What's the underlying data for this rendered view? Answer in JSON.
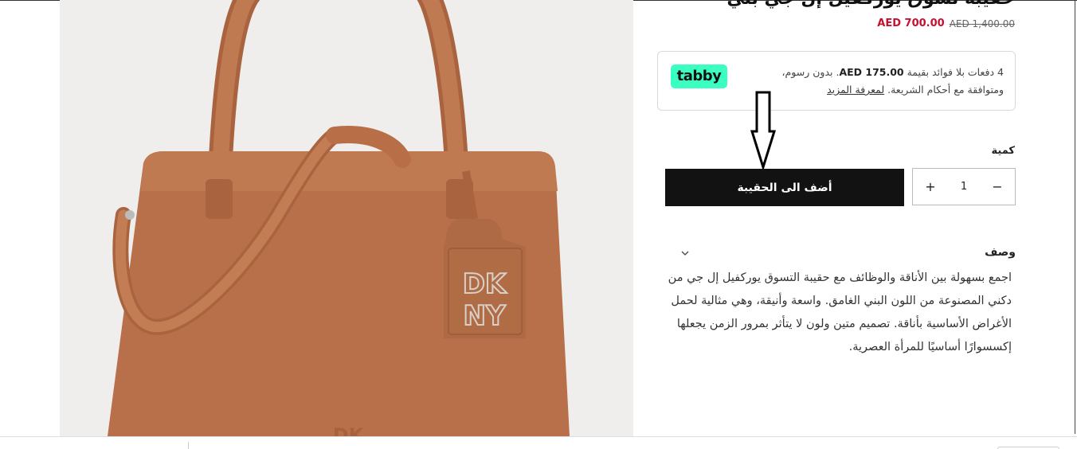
{
  "product": {
    "title": "حقيبة تسوق يوركفيل إل جي بني",
    "price_new": "AED 700.00",
    "price_old": "AED 1,400.00"
  },
  "tabby": {
    "logo_text": "tabby",
    "line1_prefix": "4 دفعات بلا فوائد بقيمة",
    "amount": "AED 175.00",
    "line1_suffix": ". بدون رسوم،",
    "line2": "ومتوافقة مع أحكام الشريعة.",
    "learn_more": "لمعرفة المزيد"
  },
  "quantity": {
    "label": "كمية",
    "value": "1",
    "plus": "+",
    "minus": "−"
  },
  "add_to_bag": "أضف الى الحقيبة",
  "description": {
    "title": "وصف",
    "text": "اجمع بسهولة بين الأناقة والوظائف مع حقيبة التسوق يوركفيل إل جي من دكني المصنوعة من اللون البني الغامق. واسعة وأنيقة، وهي مثالية لحمل الأغراض الأساسية بأناقة. تصميم متين ولون لا يتأثر بمرور الزمن يجعلها إكسسوارًا أساسيًا للمرأة العصرية."
  },
  "image": {
    "tag_logo_top": "DK",
    "tag_logo_bottom": "NY",
    "bag_color": "#b8704a"
  }
}
